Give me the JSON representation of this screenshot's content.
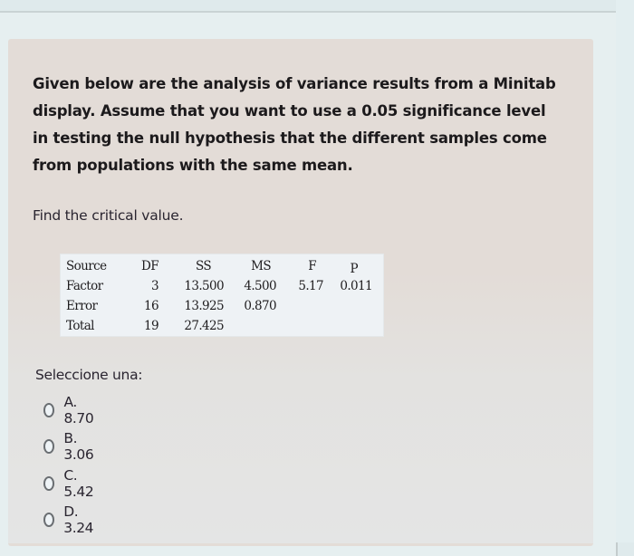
{
  "question": {
    "lines": [
      "Given below are the analysis of variance results from a Minitab",
      "display. Assume that you want to use a 0.05 significance level",
      "in testing the null hypothesis that the different samples come",
      "from populations with the same mean."
    ],
    "prompt": "Find the critical value."
  },
  "anova": {
    "headers": [
      "Source",
      "DF",
      "SS",
      "MS",
      "F",
      "P"
    ],
    "rows": [
      [
        "Factor",
        "3",
        "13.500",
        "4.500",
        "5.17",
        "0.011"
      ],
      [
        "Error",
        "16",
        "13.925",
        "0.870",
        "",
        ""
      ],
      [
        "Total",
        "19",
        "27.425",
        "",
        "",
        ""
      ]
    ]
  },
  "answer": {
    "label": "Seleccione una:",
    "selected": null,
    "options": [
      {
        "letter": "A.",
        "value": "8.70",
        "text": "A. 8.70"
      },
      {
        "letter": "B.",
        "value": "3.06",
        "text": "B. 3.06"
      },
      {
        "letter": "C.",
        "value": "5.42",
        "text": "C. 5.42"
      },
      {
        "letter": "D.",
        "value": "3.24",
        "text": "D. 3.24"
      }
    ]
  },
  "colors": {
    "background": "#dfeaec",
    "card": "#e3dcd7",
    "table_bg": "#eef2f5",
    "text": "#1c1a1c"
  }
}
